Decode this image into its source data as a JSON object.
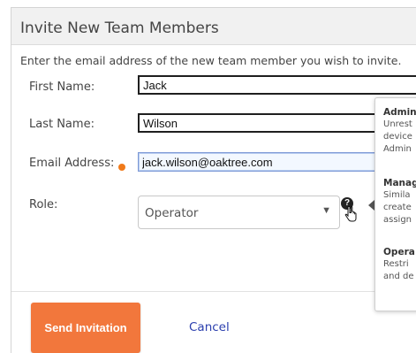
{
  "dialog": {
    "title": "Invite New Team Members",
    "intro": "Enter the email address of the new team member you wish to invite."
  },
  "form": {
    "first_name_label": "First Name:",
    "first_name_value": "Jack",
    "last_name_label": "Last Name:",
    "last_name_value": "Wilson",
    "email_label": "Email Address:",
    "email_value": "jack.wilson@oaktree.com",
    "role_label": "Role:",
    "role_value": "Operator",
    "role_arrow": "▼",
    "help_glyph": "?"
  },
  "actions": {
    "send_label": "Send Invitation",
    "cancel_label": "Cancel"
  },
  "tooltip": {
    "admin_title": "Admin",
    "admin_lines": [
      "Unrest",
      "device",
      "Admin"
    ],
    "manager_title": "Manag",
    "manager_lines": [
      "Simila",
      "create",
      "assign"
    ],
    "operator_title": "Opera",
    "operator_lines": [
      "Restri",
      "and de"
    ]
  },
  "colors": {
    "accent": "#f2773c",
    "required": "#f07a1a",
    "link": "#2b3fae",
    "focus_border": "#7d99d6"
  },
  "icons": {
    "help": "help-icon",
    "cursor": "pointer-cursor-icon",
    "required": "required-dot-icon"
  }
}
